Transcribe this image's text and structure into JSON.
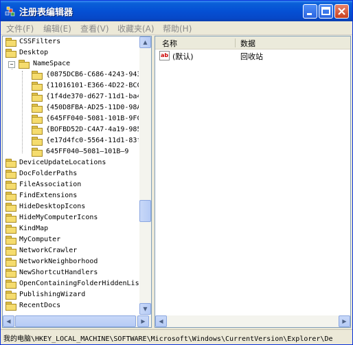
{
  "window": {
    "title": "注册表编辑器"
  },
  "menu": [
    "文件(F)",
    "编辑(E)",
    "查看(V)",
    "收藏夹(A)",
    "帮助(H)"
  ],
  "tree": {
    "top_items": [
      "CSSFilters",
      "Desktop"
    ],
    "namespace_label": "NameSpace",
    "namespace_children": [
      "{0875DCB6-C686-4243-943",
      "{11016101-E366-4D22-BCC",
      "{1f4de370-d627-11d1-ba4",
      "{450D8FBA-AD25-11D0-98A",
      "{645FF040-5081-101B-9FC",
      "{BOFBD52D-C4A7-4a19-985",
      "{e17d4fc0-5564-11d1-83f",
      "645FF040—5081—101B—9"
    ],
    "bottom_items": [
      "DeviceUpdateLocations",
      "DocFolderPaths",
      "FileAssociation",
      "FindExtensions",
      "HideDesktopIcons",
      "HideMyComputerIcons",
      "KindMap",
      "MyComputer",
      "NetworkCrawler",
      "NetworkNeighborhood",
      "NewShortcutHandlers",
      "OpenContainingFolderHiddenLis",
      "PublishingWizard",
      "RecentDocs"
    ]
  },
  "list": {
    "headers": [
      "名称",
      "数据"
    ],
    "rows": [
      {
        "icon": "ab",
        "name": "(默认)",
        "data": "回收站"
      }
    ]
  },
  "status": "我的电脑\\HKEY_LOCAL_MACHINE\\SOFTWARE\\Microsoft\\Windows\\CurrentVersion\\Explorer\\De"
}
